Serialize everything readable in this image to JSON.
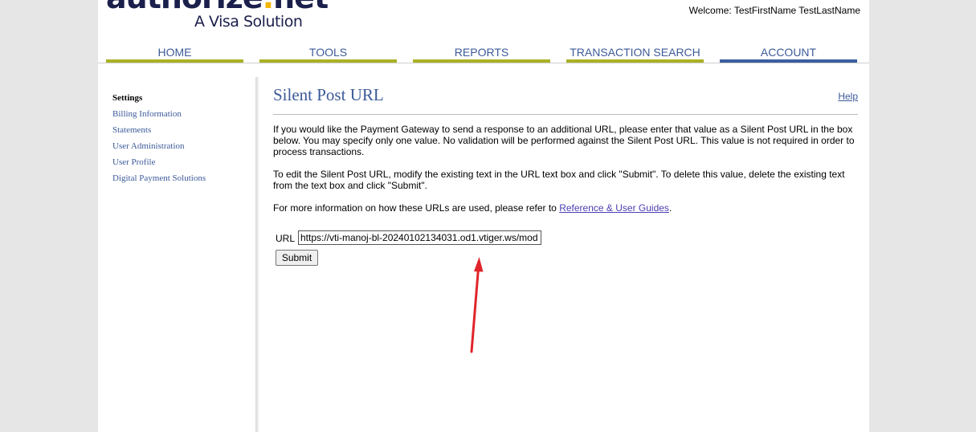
{
  "brand": {
    "logo_text_main": "authorize",
    "logo_text_dot": ".",
    "logo_text_end": "net",
    "logo_subtitle": "A Visa Solution"
  },
  "header": {
    "welcome": "Welcome: TestFirstName TestLastName"
  },
  "nav": {
    "tabs": [
      {
        "label": "HOME",
        "active": false
      },
      {
        "label": "TOOLS",
        "active": false
      },
      {
        "label": "REPORTS",
        "active": false
      },
      {
        "label": "TRANSACTION SEARCH",
        "active": false
      },
      {
        "label": "ACCOUNT",
        "active": true
      }
    ]
  },
  "sidebar": {
    "items": [
      {
        "label": "Settings",
        "current": true
      },
      {
        "label": "Billing Information"
      },
      {
        "label": "Statements"
      },
      {
        "label": "User Administration"
      },
      {
        "label": "User Profile"
      },
      {
        "label": "Digital Payment Solutions"
      }
    ]
  },
  "main": {
    "title": "Silent Post URL",
    "help": "Help",
    "paragraph1": "If you would like the Payment Gateway to send a response to an additional URL, please enter that value as a Silent Post URL in the box below. You may specify only one value. No validation will be performed against the Silent Post URL. This value is not required in order to process transactions.",
    "paragraph2": "To edit the Silent Post URL, modify the existing text in the URL text box and click \"Submit\". To delete this value, delete the existing text from the text box and click \"Submit\".",
    "paragraph3_prefix": "For more information on how these URLs are used, please refer to ",
    "paragraph3_link": "Reference & User Guides",
    "paragraph3_suffix": ".",
    "url_label": "URL",
    "url_value": "https://vti-manoj-bl-20240102134031.od1.vtiger.ws/mod",
    "submit_label": "Submit"
  },
  "colors": {
    "brand_navy": "#1a1f4b",
    "brand_gold": "#f2b705",
    "link_blue": "#3c5a99",
    "tab_bar_olive": "#a9b225",
    "tab_bar_active": "#3b5ea0",
    "annotation_arrow": "#e0242b"
  }
}
